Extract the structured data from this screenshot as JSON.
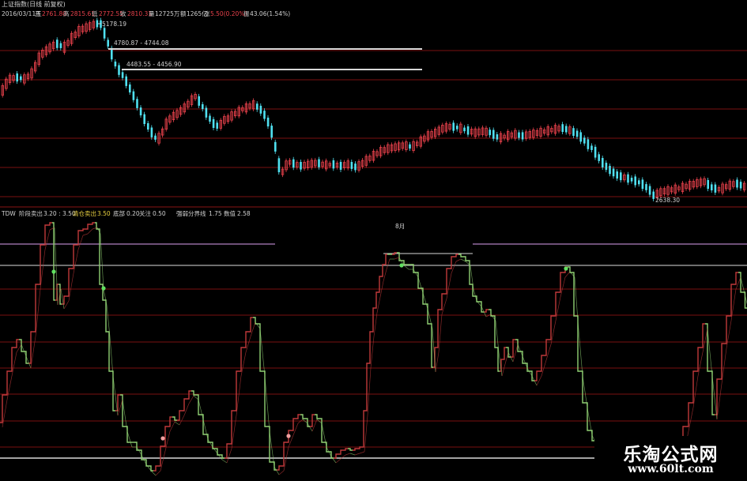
{
  "price_panel": {
    "title": "上证指数(日线 前复权)",
    "info": {
      "date": "2016/03/11五",
      "open_label": "开",
      "open": "2761.80",
      "high_label": "高",
      "high": "2815.61",
      "low_label": "低",
      "low": "2772.55",
      "close_label": "收",
      "close": "2810.31",
      "volume_label": "量",
      "volume": "12725万",
      "amount_label": "额",
      "amount": "1265亿",
      "change_label": "涨",
      "change": "5.50(0.20%)",
      "turnover_label": "振",
      "turnover": "43.06(1.54%)"
    },
    "annotations": {
      "high_price": "5178.19",
      "gap_1": "4780.87 - 4744.08",
      "gap_2": "4483.55 - 4456.90",
      "low_price": "2638.30"
    },
    "colors": {
      "up": "#e8414b",
      "down": "#4fe0f0",
      "background": "#000000",
      "grid": "#7a1010"
    }
  },
  "indicator_panel": {
    "name": "TDW",
    "params": [
      {
        "label": "阶段卖出",
        "value": "3.20 : 3.50"
      },
      {
        "label": "清仓卖出",
        "value": "3.50"
      },
      {
        "label": "底部",
        "value": "0.20"
      },
      {
        "label": "关注",
        "value": "0.50"
      },
      {
        "label": "强弱分界线",
        "value": "1.75"
      },
      {
        "label": "数值",
        "value": "2.58"
      }
    ],
    "marker_text": "8月",
    "colors": {
      "rise": "#c0393a",
      "fall": "#8fcf72",
      "level_line": "#b0b0b0",
      "purple_line": "#b080c0",
      "grid": "#7a1010"
    }
  },
  "watermark": {
    "brand": "乐淘公式网",
    "url": "www.60lt.com"
  }
}
